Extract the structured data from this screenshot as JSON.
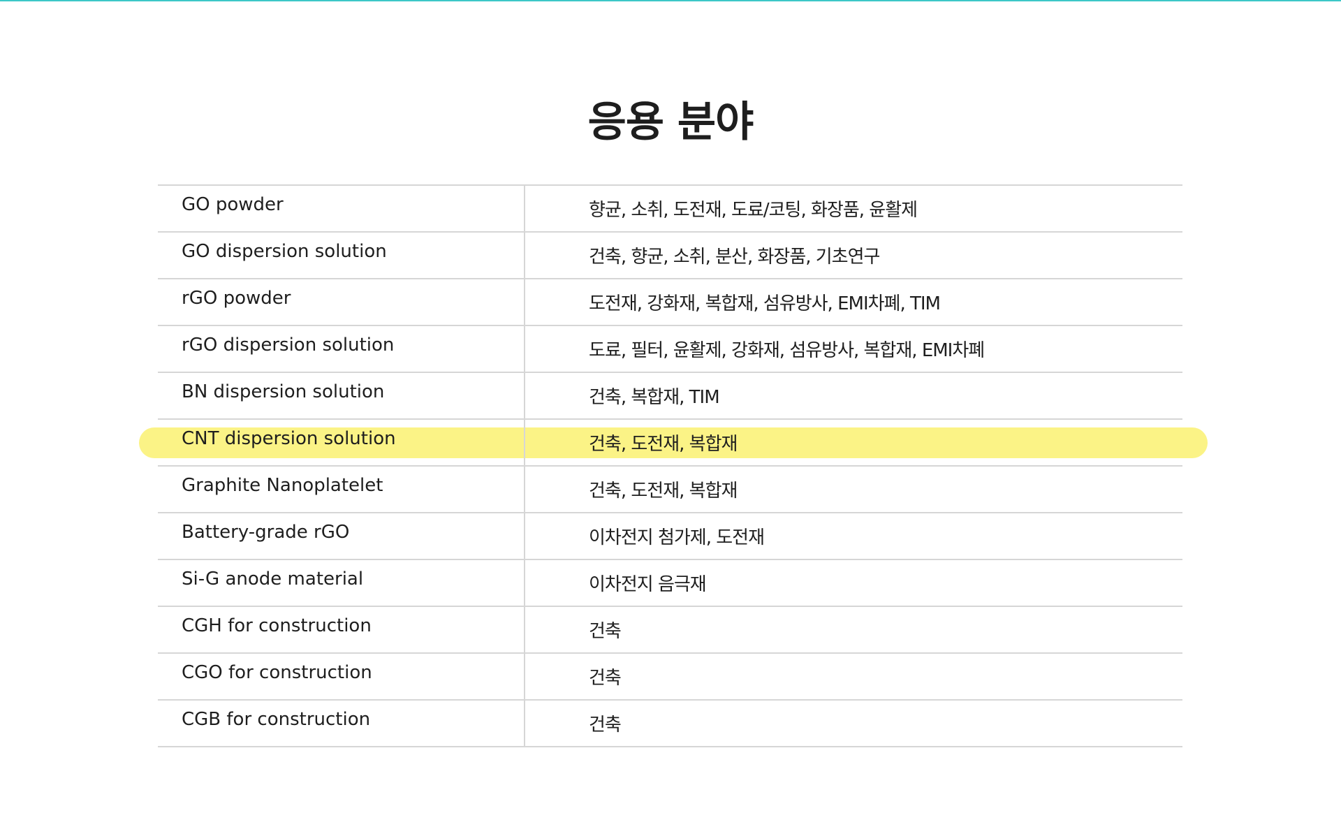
{
  "page": {
    "title": "응용 분야"
  },
  "colors": {
    "accent_line": "#3cc7c7",
    "highlight": "#fbf386",
    "divider": "#d6d6d6",
    "text": "#1e1e1e"
  },
  "table": {
    "highlighted_row": 5,
    "rows": [
      {
        "product": "GO powder",
        "applications": "향균, 소취, 도전재, 도료/코팅, 화장품, 윤활제"
      },
      {
        "product": "GO dispersion solution",
        "applications": "건축, 향균, 소취, 분산, 화장품, 기초연구"
      },
      {
        "product": "rGO powder",
        "applications": "도전재, 강화재, 복합재, 섬유방사, EMI차폐, TIM"
      },
      {
        "product": "rGO dispersion solution",
        "applications": "도료, 필터, 윤활제, 강화재, 섬유방사, 복합재, EMI차폐"
      },
      {
        "product": "BN dispersion solution",
        "applications": "건축, 복합재, TIM"
      },
      {
        "product": "CNT dispersion solution",
        "applications": "건축, 도전재, 복합재"
      },
      {
        "product": "Graphite Nanoplatelet",
        "applications": "건축, 도전재, 복합재"
      },
      {
        "product": "Battery-grade rGO",
        "applications": "이차전지 첨가제, 도전재"
      },
      {
        "product": "Si-G anode material",
        "applications": "이차전지 음극재"
      },
      {
        "product": "CGH for construction",
        "applications": "건축"
      },
      {
        "product": "CGO for construction",
        "applications": "건축"
      },
      {
        "product": "CGB for construction",
        "applications": "건축"
      }
    ]
  }
}
